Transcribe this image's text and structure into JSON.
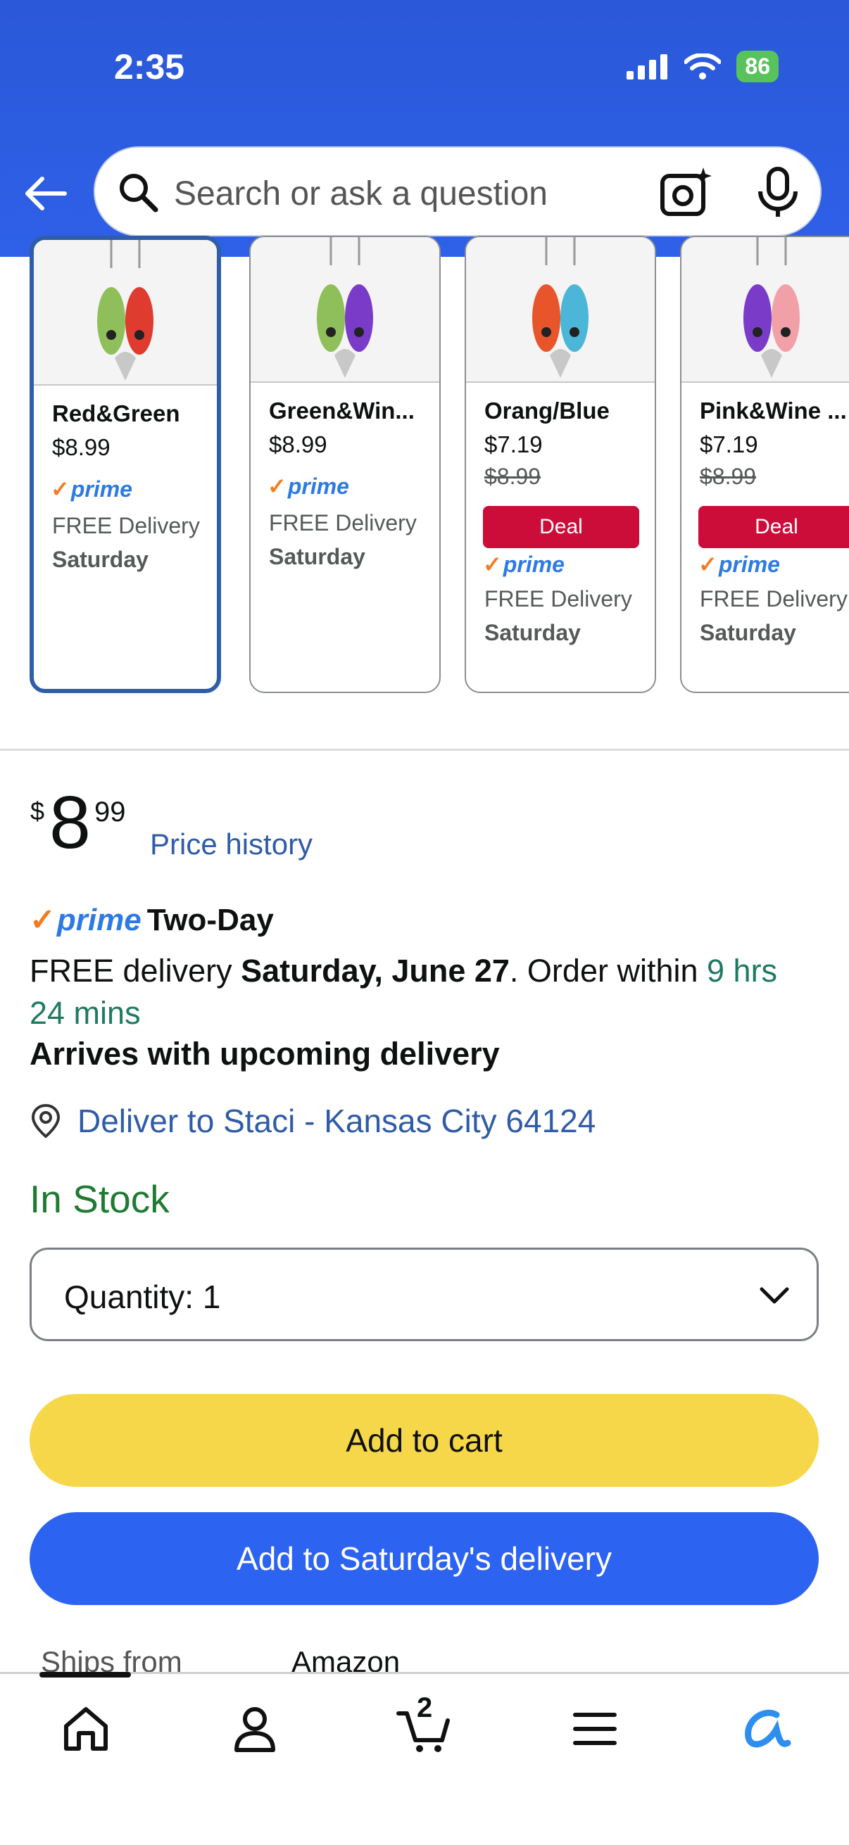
{
  "status_bar": {
    "time": "2:35",
    "battery": "86"
  },
  "search": {
    "placeholder": "Search or ask a question"
  },
  "variants": [
    {
      "name": "Red&Green",
      "price": "$8.99",
      "list_price": "",
      "deal": "",
      "prime": "prime",
      "delivery": "FREE Delivery",
      "day": "Saturday",
      "selected": true,
      "colors": [
        "#8fbf5a",
        "#e03b2f"
      ]
    },
    {
      "name": "Green&Win...",
      "price": "$8.99",
      "list_price": "",
      "deal": "",
      "prime": "prime",
      "delivery": "FREE Delivery",
      "day": "Saturday",
      "selected": false,
      "colors": [
        "#8fbf5a",
        "#7a3cc8"
      ]
    },
    {
      "name": "Orang/Blue",
      "price": "$7.19",
      "list_price": "$8.99",
      "deal": "Deal",
      "prime": "prime",
      "delivery": "FREE Delivery",
      "day": "Saturday",
      "selected": false,
      "colors": [
        "#e8552b",
        "#4cb6d8"
      ]
    },
    {
      "name": "Pink&Wine ...",
      "price": "$7.19",
      "list_price": "$8.99",
      "deal": "Deal",
      "prime": "prime",
      "delivery": "FREE Delivery",
      "day": "Saturday",
      "selected": false,
      "colors": [
        "#7a3cc8",
        "#f2a0a8"
      ]
    }
  ],
  "price": {
    "currency": "$",
    "whole": "8",
    "cents": "99",
    "history_link": "Price history"
  },
  "prime_badge": {
    "prime": "prime",
    "label": "Two-Day"
  },
  "delivery": {
    "prefix": "FREE delivery ",
    "date": "Saturday, June 27",
    "middle": ". Order within ",
    "countdown": "9 hrs 24 mins",
    "arrives": "Arrives with upcoming delivery"
  },
  "deliver_to": "Deliver to Staci - Kansas City 64124",
  "stock": "In Stock",
  "quantity": {
    "label": "Quantity:",
    "value": "1"
  },
  "buttons": {
    "add_to_cart": "Add to cart",
    "add_to_delivery": "Add to Saturday's delivery"
  },
  "ships": {
    "label": "Ships from",
    "value": "Amazon"
  },
  "tabbar": {
    "cart_count": "2"
  },
  "colors": {
    "header": "#2e60e8",
    "cart_button": "#f6d74a",
    "delivery_button": "#2c63f0",
    "link": "#2f5ba8",
    "stock": "#1f7a32",
    "deal": "#cc0c39"
  }
}
